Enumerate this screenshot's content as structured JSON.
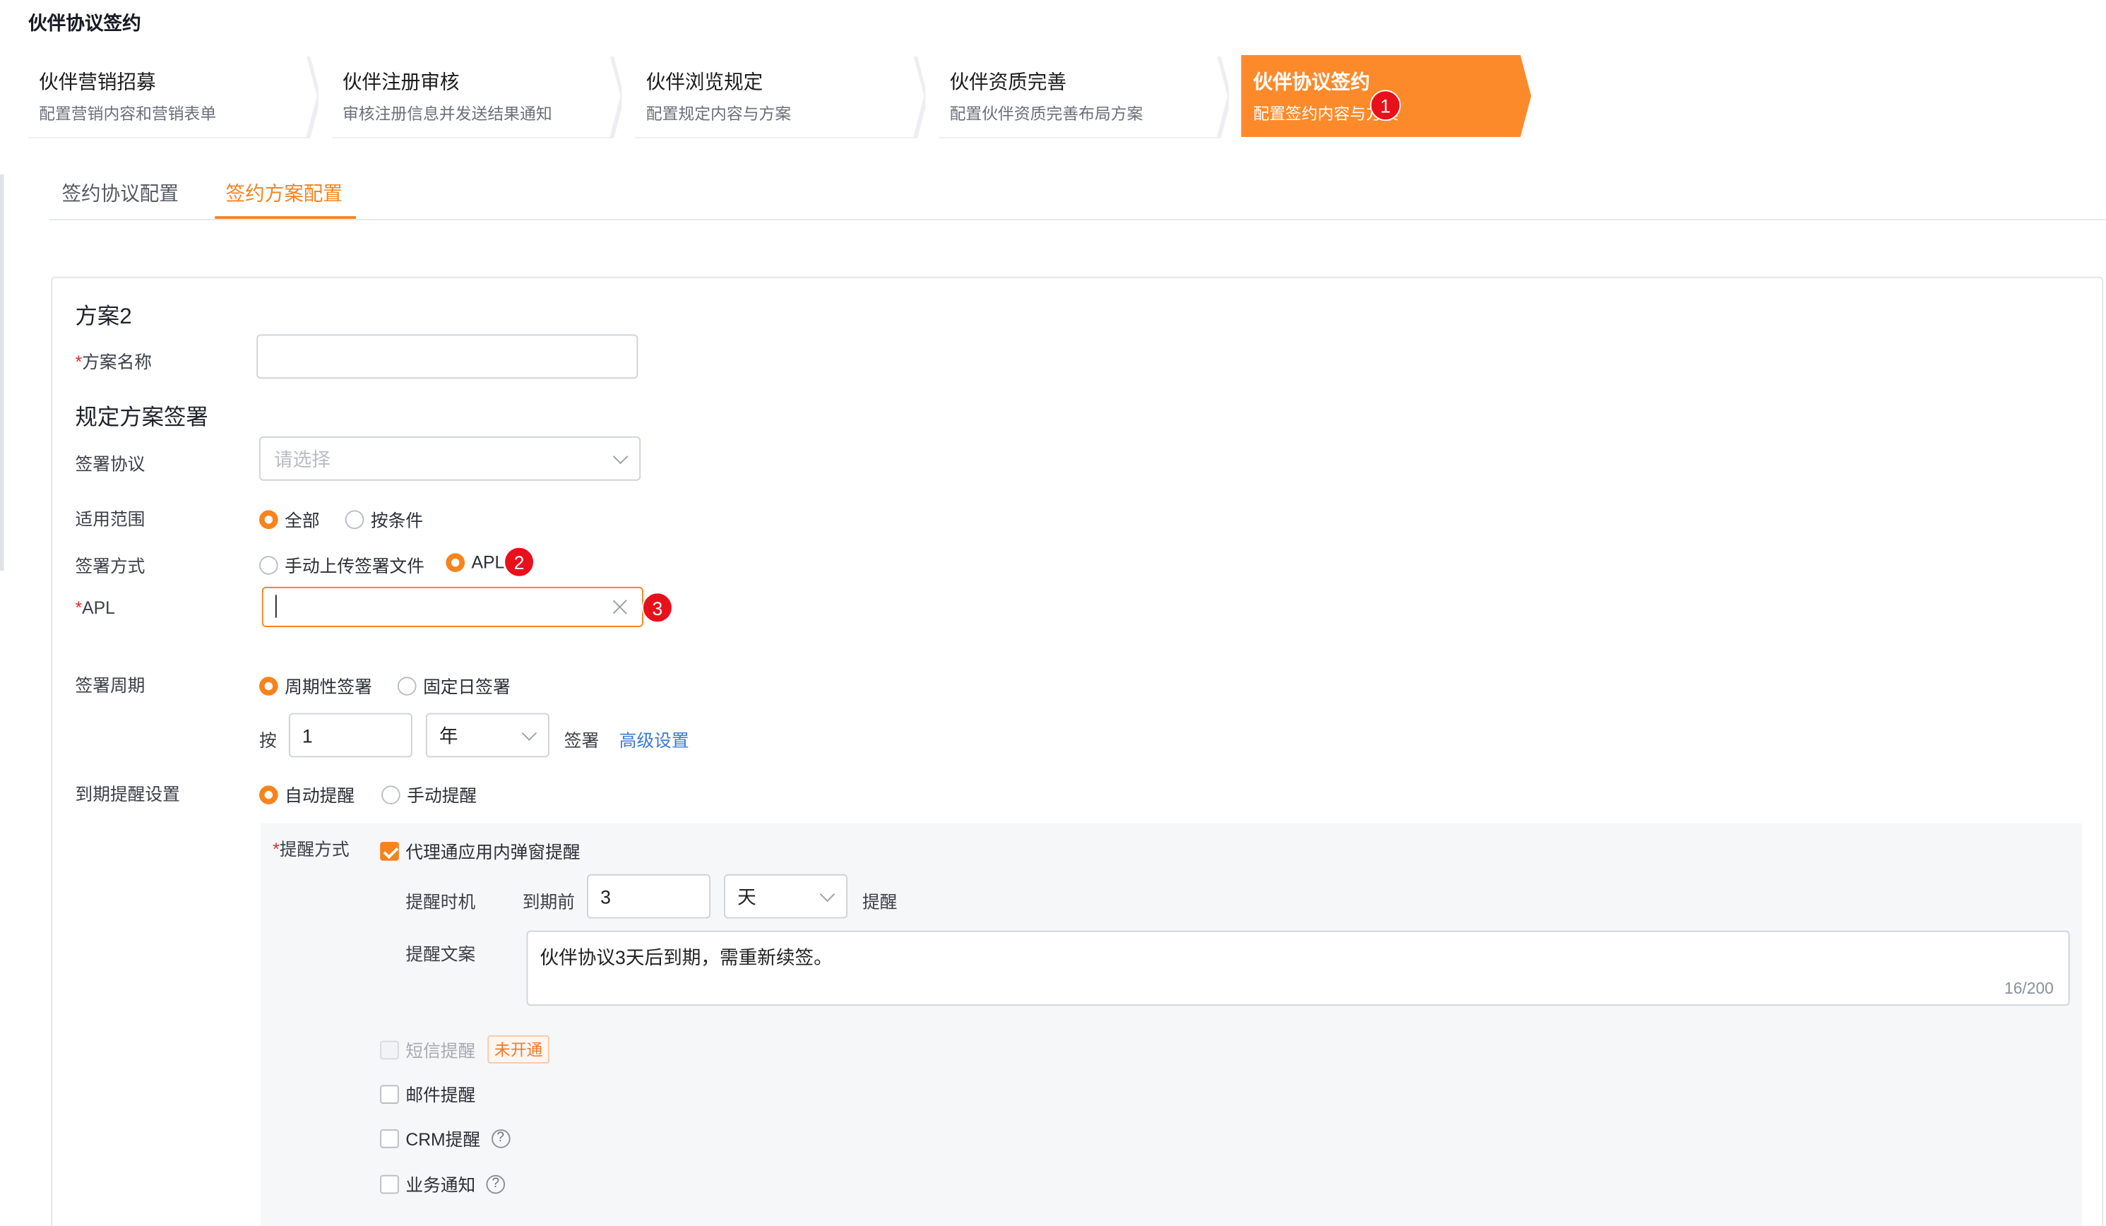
{
  "page": {
    "title": "伙伴协议签约"
  },
  "steps": [
    {
      "title": "伙伴营销招募",
      "desc": "配置营销内容和营销表单"
    },
    {
      "title": "伙伴注册审核",
      "desc": "审核注册信息并发送结果通知"
    },
    {
      "title": "伙伴浏览规定",
      "desc": "配置规定内容与方案"
    },
    {
      "title": "伙伴资质完善",
      "desc": "配置伙伴资质完善布局方案"
    },
    {
      "title": "伙伴协议签约",
      "desc": "配置签约内容与方案",
      "active": true
    }
  ],
  "badges": [
    "1",
    "2",
    "3"
  ],
  "tabs": [
    {
      "label": "签约协议配置"
    },
    {
      "label": "签约方案配置",
      "active": true
    }
  ],
  "form": {
    "plan_title": "方案2",
    "req_mark": "*",
    "plan_name_label": "方案名称",
    "plan_name_value": "",
    "section_title": "规定方案签署",
    "agreement_label": "签署协议",
    "agreement_placeholder": "请选择",
    "scope_label": "适用范围",
    "scope_options": [
      "全部",
      "按条件"
    ],
    "scope_selected": "全部",
    "method_label": "签署方式",
    "method_options": [
      "手动上传签署文件",
      "APL"
    ],
    "method_selected": "APL",
    "apl_label": "APL",
    "apl_value": "",
    "cycle_label": "签署周期",
    "cycle_options": [
      "周期性签署",
      "固定日签署"
    ],
    "cycle_selected": "周期性签署",
    "cycle_by": "按",
    "cycle_number": "1",
    "cycle_unit": "年",
    "cycle_suffix": "签署",
    "advanced_link": "高级设置",
    "expiry_label": "到期提醒设置",
    "expiry_options": [
      "自动提醒",
      "手动提醒"
    ],
    "expiry_selected": "自动提醒",
    "remind_method_label": "提醒方式",
    "remind_popup": "代理通应用内弹窗提醒",
    "remind_time_label": "提醒时机",
    "remind_time_prefix": "到期前",
    "remind_time_value": "3",
    "remind_time_unit": "天",
    "remind_time_suffix": "提醒",
    "remind_text_label": "提醒文案",
    "remind_text_value": "伙伴协议3天后到期，需重新续签。",
    "remind_text_count": "16/200",
    "sms_label": "短信提醒",
    "sms_status": "未开通",
    "email_label": "邮件提醒",
    "crm_label": "CRM提醒",
    "biz_label": "业务通知",
    "help_glyph": "?"
  },
  "colors": {
    "accent": "#f7831d",
    "active_step": "#fd8a2a",
    "badge": "#e8101a",
    "link": "#3a7bd5"
  }
}
